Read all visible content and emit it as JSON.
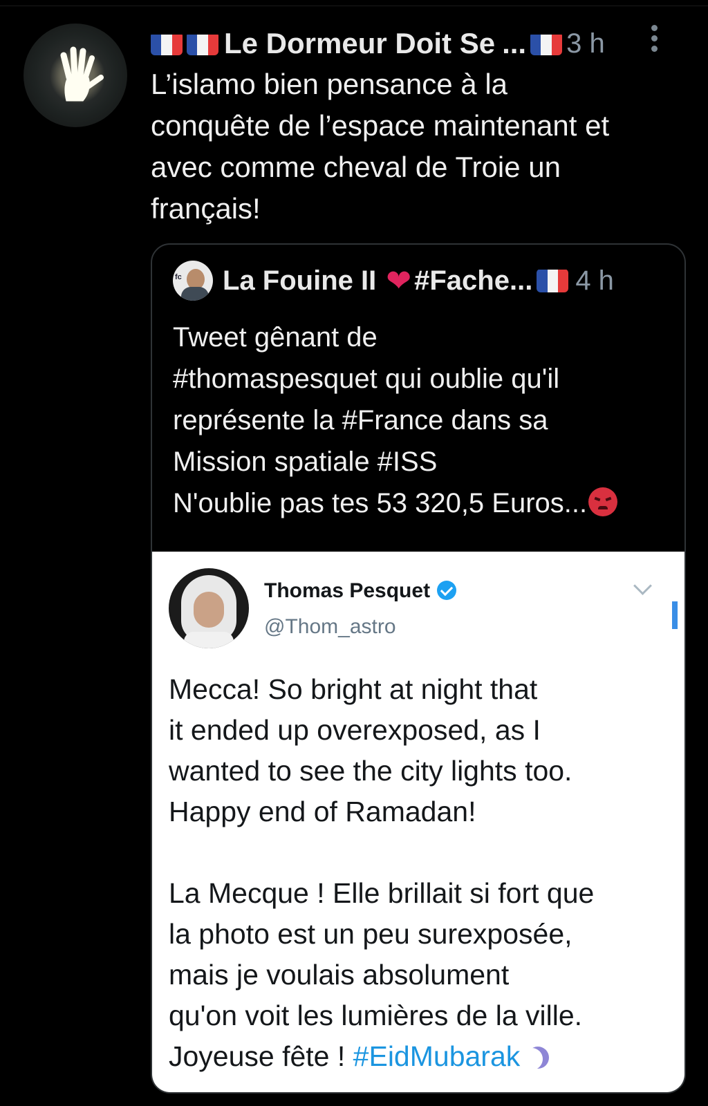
{
  "tweet": {
    "display_name": "Le Dormeur Doit Se",
    "truncation": "...",
    "time": "3 h",
    "text": "L’islamo bien pensance à la\nconquête de l’espace maintenant et\navec comme cheval de Troie un\nfrançais!"
  },
  "quoted": {
    "name": "La Fouine II",
    "hashtag": "#Fache...",
    "time": "4 h",
    "text": "Tweet gênant de\n#thomaspesquet qui oublie qu'il\nreprésente la #France dans sa\nMission spatiale #ISS\nN'oublie pas tes 53 320,5 Euros...",
    "avatar_tag": "fc"
  },
  "screenshot": {
    "name": "Thomas Pesquet",
    "handle": "@Thom_astro",
    "text": "Mecca! So bright at night that\nit ended up overexposed, as I\nwanted to see the city lights too.\nHappy end of Ramadan!\n\nLa Mecque ! Elle brillait si fort que\nla photo est un peu surexposée,\nmais je voulais absolument\nqu'on voit les lumières de la ville.\nJoyeuse fête ! ",
    "hashtag": "#EidMubarak"
  },
  "colors": {
    "background": "#000000",
    "muted": "#8b98a5",
    "link": "#1b95e0",
    "heart": "#e0245e",
    "verified": "#1da1f2"
  },
  "icons": [
    "waving-hand-avatar",
    "french-flag-icon",
    "more-options-icon",
    "red-heart-icon",
    "angry-face-icon",
    "verified-badge-icon",
    "chevron-down-icon",
    "crescent-moon-icon"
  ]
}
